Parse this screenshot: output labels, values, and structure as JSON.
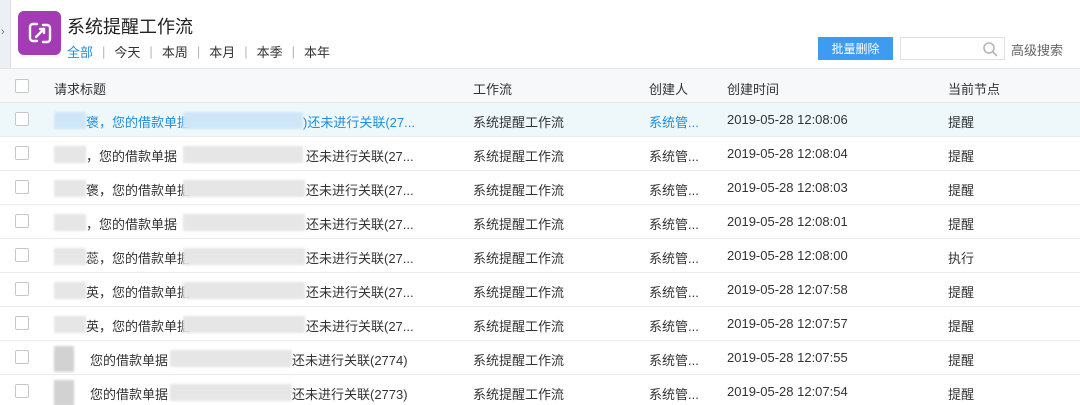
{
  "app": {
    "title": "系统提醒工作流"
  },
  "filter_tabs": [
    {
      "label": "全部",
      "active": true
    },
    {
      "label": "今天",
      "active": false
    },
    {
      "label": "本周",
      "active": false
    },
    {
      "label": "本月",
      "active": false
    },
    {
      "label": "本季",
      "active": false
    },
    {
      "label": "本年",
      "active": false
    }
  ],
  "toolbar": {
    "batch_delete_label": "批量删除",
    "search_placeholder": "",
    "advanced_search_label": "高级搜索"
  },
  "table": {
    "columns": [
      "请求标题",
      "工作流",
      "创建人",
      "创建时间",
      "当前节点"
    ],
    "rows": [
      {
        "title_a": "褒，您的借款单据",
        "title_b": ")还未进行关联(27...",
        "workflow": "系统提醒工作流",
        "creator": "系统管...",
        "time": "2019-05-28 12:08:06",
        "node": "提醒"
      },
      {
        "title_a": "，您的借款单据",
        "title_b": "还未进行关联(27...",
        "workflow": "系统提醒工作流",
        "creator": "系统管...",
        "time": "2019-05-28 12:08:04",
        "node": "提醒"
      },
      {
        "title_a": "褒，您的借款单据",
        "title_b": "还未进行关联(27...",
        "workflow": "系统提醒工作流",
        "creator": "系统管...",
        "time": "2019-05-28 12:08:03",
        "node": "提醒"
      },
      {
        "title_a": "，您的借款单据",
        "title_b": "还未进行关联(27...",
        "workflow": "系统提醒工作流",
        "creator": "系统管...",
        "time": "2019-05-28 12:08:01",
        "node": "提醒"
      },
      {
        "title_a": "蕊，您的借款单据",
        "title_b": "还未进行关联(27...",
        "workflow": "系统提醒工作流",
        "creator": "系统管...",
        "time": "2019-05-28 12:08:00",
        "node": "执行"
      },
      {
        "title_a": "英，您的借款单据",
        "title_b": "还未进行关联(27...",
        "workflow": "系统提醒工作流",
        "creator": "系统管...",
        "time": "2019-05-28 12:07:58",
        "node": "提醒"
      },
      {
        "title_a": "英，您的借款单据",
        "title_b": "还未进行关联(27...",
        "workflow": "系统提醒工作流",
        "creator": "系统管...",
        "time": "2019-05-28 12:07:57",
        "node": "提醒"
      },
      {
        "title_a": "您的借款单据",
        "title_b": "还未进行关联(2774)",
        "workflow": "系统提醒工作流",
        "creator": "系统管...",
        "time": "2019-05-28 12:07:55",
        "node": "提醒"
      },
      {
        "title_a": "您的借款单据",
        "title_b": "还未进行关联(2773)",
        "workflow": "系统提醒工作流",
        "creator": "系统管...",
        "time": "2019-05-28 12:07:54",
        "node": "提醒"
      }
    ]
  },
  "colors": {
    "accent": "#1e8ee0",
    "button": "#3d9cf0",
    "logo": "#a33bb4",
    "highlight_row": "#eef8fb"
  },
  "icons": [
    "chevron-right-icon",
    "app-logo-icon",
    "search-icon",
    "checkbox-icon"
  ]
}
